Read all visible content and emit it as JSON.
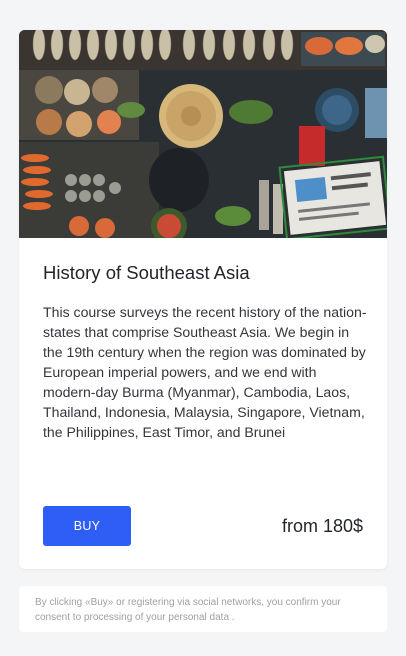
{
  "course": {
    "image_alt": "Floating market boats with food stalls",
    "title": "History of Southeast Asia",
    "description": "This course surveys the recent history of the nation-states that comprise Southeast Asia. We begin in the 19th century when the region was dominated by European imperial powers, and we end with modern-day Burma (Myanmar), Cambodia, Laos, Thailand, Indonesia, Malaysia, Singapore, Vietnam, the Philippines, East Timor, and Brunei",
    "buy_label": "BUY",
    "price_label": "from 180$"
  },
  "consent": {
    "text": "By clicking «Buy» or registering via social networks, you confirm your consent to processing of your personal data ."
  },
  "colors": {
    "accent": "#2f5ef7",
    "background": "#f4f5f7",
    "card": "#ffffff",
    "text": "#22252b",
    "muted": "#9da0a6"
  }
}
